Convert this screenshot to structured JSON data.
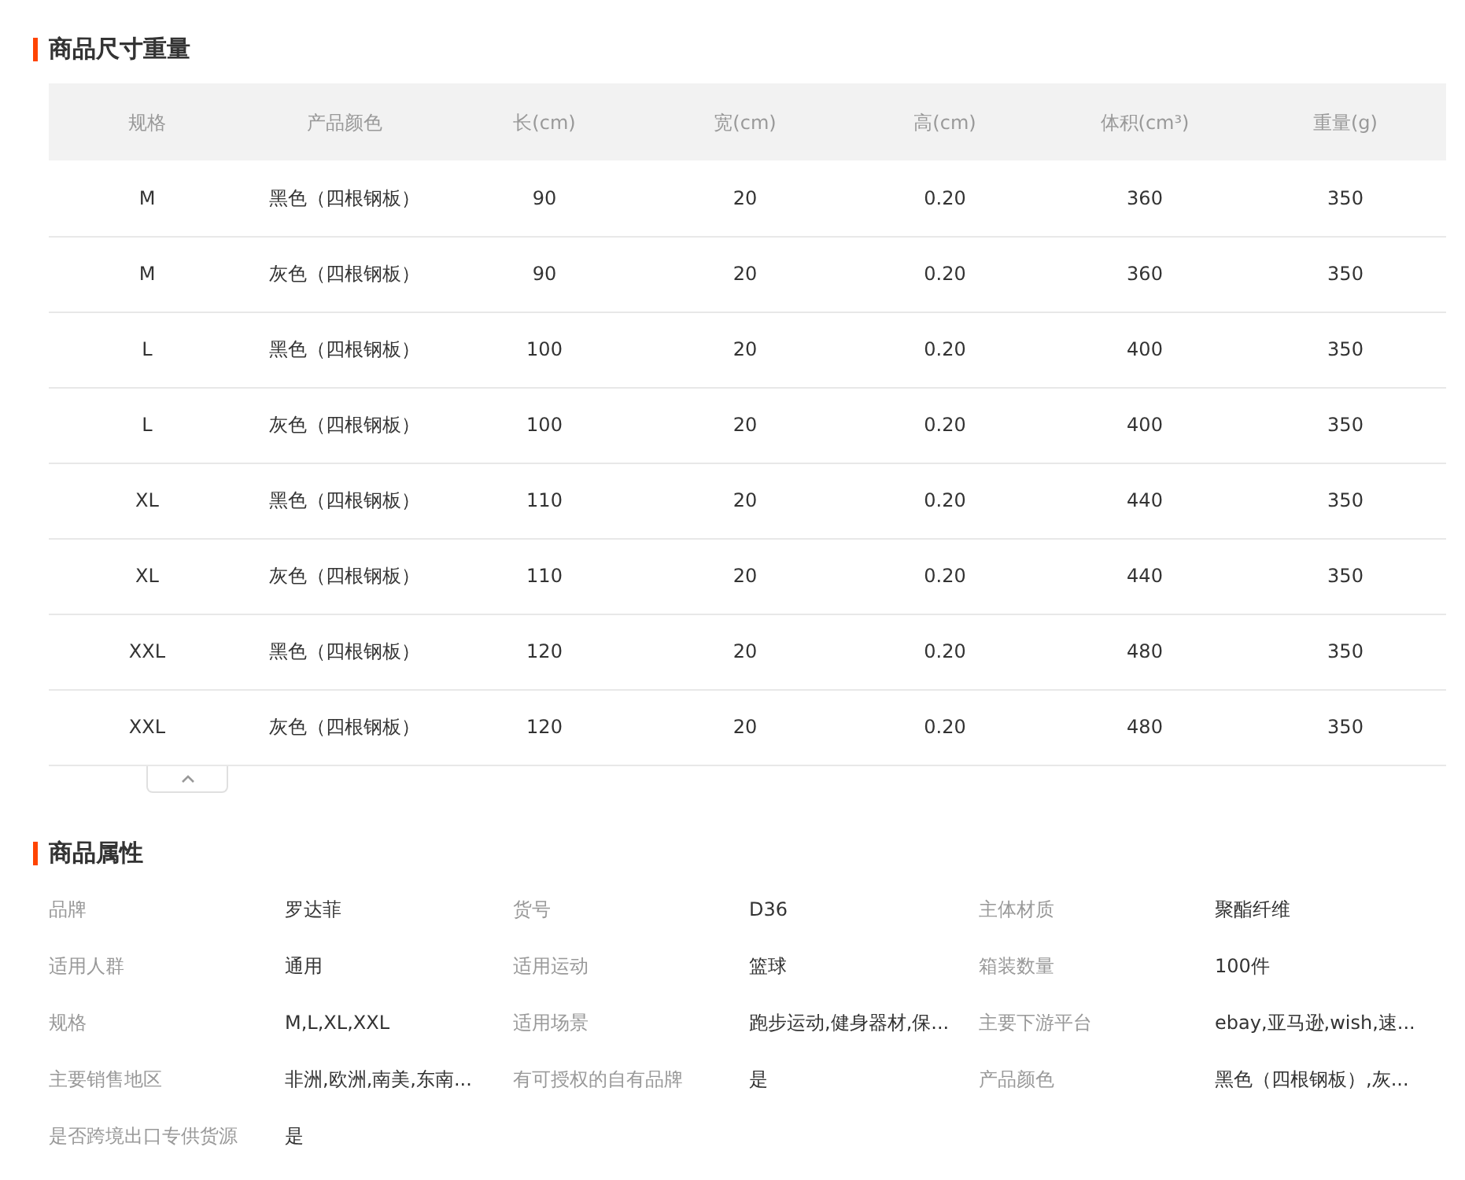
{
  "size_section": {
    "title": "商品尺寸重量",
    "columns": [
      "规格",
      "产品颜色",
      "长(cm)",
      "宽(cm)",
      "高(cm)",
      "体积(cm³)",
      "重量(g)"
    ],
    "rows": [
      [
        "M",
        "黑色（四根钢板）",
        "90",
        "20",
        "0.20",
        "360",
        "350"
      ],
      [
        "M",
        "灰色（四根钢板）",
        "90",
        "20",
        "0.20",
        "360",
        "350"
      ],
      [
        "L",
        "黑色（四根钢板）",
        "100",
        "20",
        "0.20",
        "400",
        "350"
      ],
      [
        "L",
        "灰色（四根钢板）",
        "100",
        "20",
        "0.20",
        "400",
        "350"
      ],
      [
        "XL",
        "黑色（四根钢板）",
        "110",
        "20",
        "0.20",
        "440",
        "350"
      ],
      [
        "XL",
        "灰色（四根钢板）",
        "110",
        "20",
        "0.20",
        "440",
        "350"
      ],
      [
        "XXL",
        "黑色（四根钢板）",
        "120",
        "20",
        "0.20",
        "480",
        "350"
      ],
      [
        "XXL",
        "灰色（四根钢板）",
        "120",
        "20",
        "0.20",
        "480",
        "350"
      ]
    ]
  },
  "attributes_section": {
    "title": "商品属性",
    "items": [
      {
        "label": "品牌",
        "value": "罗达菲"
      },
      {
        "label": "货号",
        "value": "D36"
      },
      {
        "label": "主体材质",
        "value": "聚酯纤维"
      },
      {
        "label": "适用人群",
        "value": "通用"
      },
      {
        "label": "适用运动",
        "value": "篮球"
      },
      {
        "label": "箱装数量",
        "value": "100件"
      },
      {
        "label": "规格",
        "value": "M,L,XL,XXL"
      },
      {
        "label": "适用场景",
        "value": "跑步运动,健身器材,保..."
      },
      {
        "label": "主要下游平台",
        "value": "ebay,亚马逊,wish,速..."
      },
      {
        "label": "主要销售地区",
        "value": "非洲,欧洲,南美,东南..."
      },
      {
        "label": "有可授权的自有品牌",
        "value": "是"
      },
      {
        "label": "产品颜色",
        "value": "黑色（四根钢板）,灰..."
      },
      {
        "label": "是否跨境出口专供货源",
        "value": "是"
      }
    ]
  }
}
